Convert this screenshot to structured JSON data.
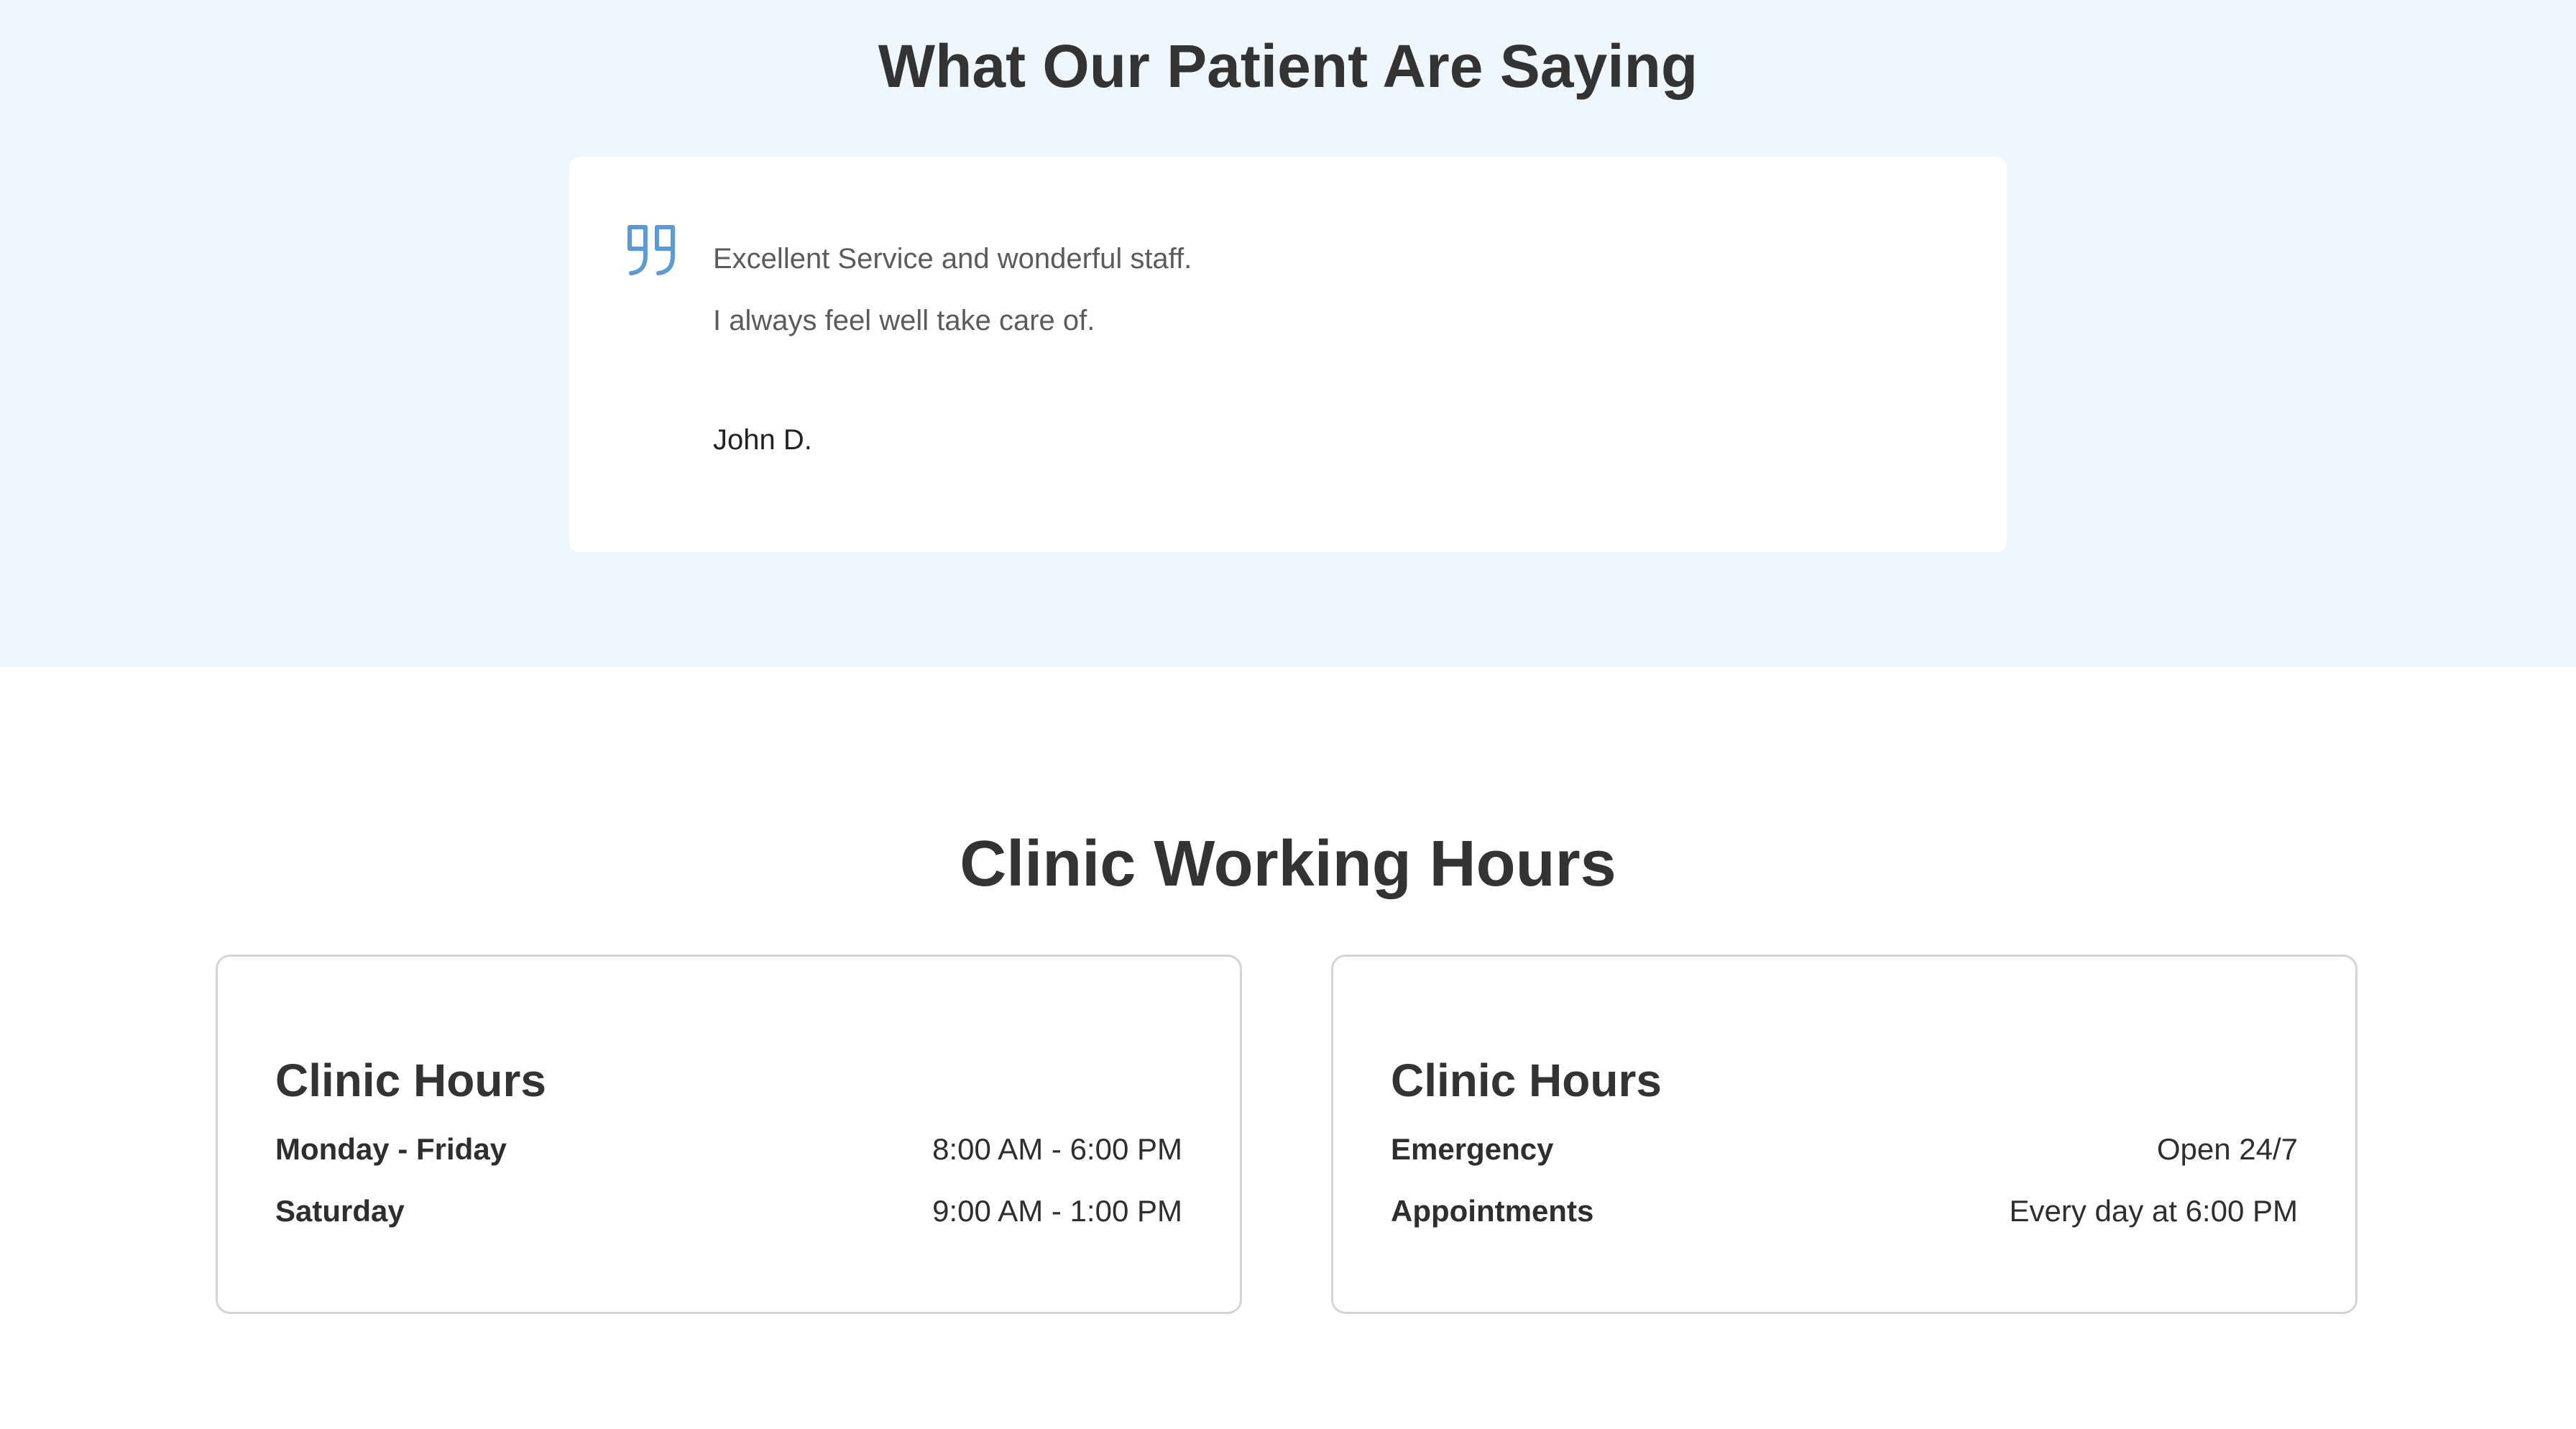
{
  "testimonials": {
    "title": "What Our Patient Are Saying",
    "quote_icon": "quote-icon",
    "accent_color": "#5b9bd5",
    "background_color": "#eef6fe",
    "items": [
      {
        "lines": [
          "Excellent Service and wonderful staff.",
          "I always feel well take care of."
        ],
        "author": "John D."
      }
    ]
  },
  "hours": {
    "title": "Clinic Working Hours",
    "cards": [
      {
        "heading": "Clinic Hours",
        "rows": [
          {
            "label": "Monday - Friday",
            "value": "8:00 AM - 6:00 PM"
          },
          {
            "label": "Saturday",
            "value": "9:00 AM - 1:00 PM"
          }
        ]
      },
      {
        "heading": "Clinic Hours",
        "rows": [
          {
            "label": "Emergency",
            "value": "Open 24/7"
          },
          {
            "label": "Appointments",
            "value": "Every day at 6:00 PM"
          }
        ]
      }
    ]
  }
}
